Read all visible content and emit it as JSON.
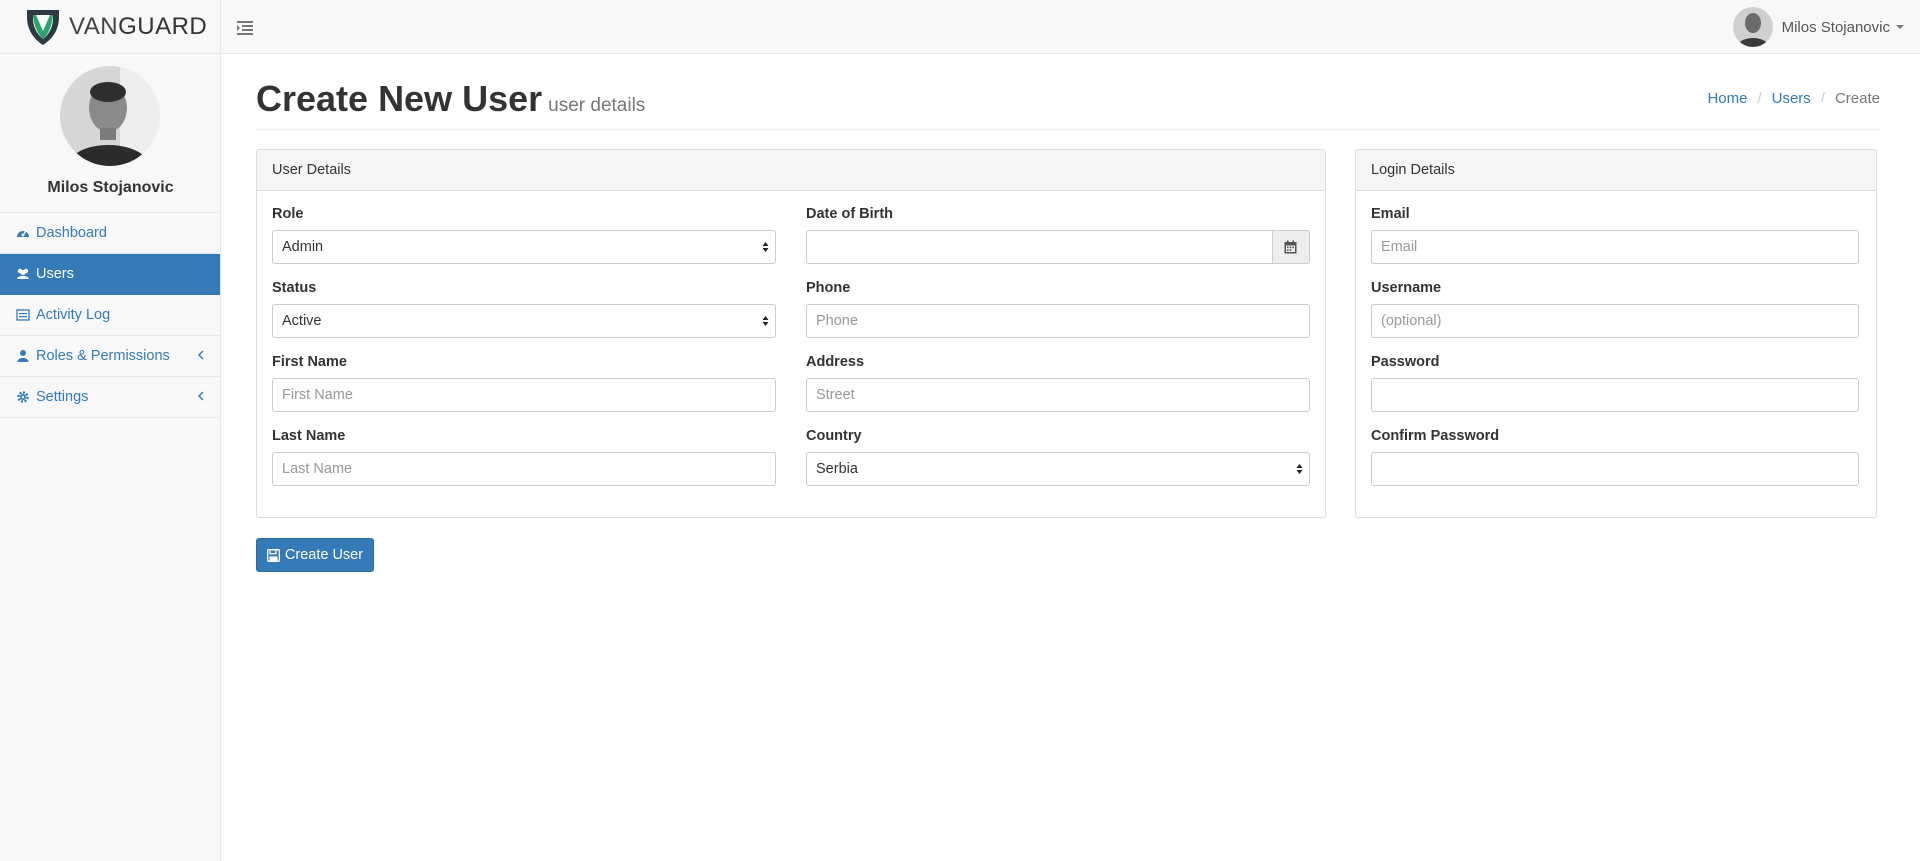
{
  "brand": {
    "name_light": "VAN",
    "name_bold": "GUARD"
  },
  "header": {
    "user_name": "Milos Stojanovic"
  },
  "sidebar": {
    "profile_name": "Milos Stojanovic",
    "items": [
      {
        "label": "Dashboard",
        "icon": "dashboard-icon"
      },
      {
        "label": "Users",
        "icon": "users-icon",
        "active": true
      },
      {
        "label": "Activity Log",
        "icon": "list-icon"
      },
      {
        "label": "Roles & Permissions",
        "icon": "user-icon",
        "has_children": true
      },
      {
        "label": "Settings",
        "icon": "gear-icon",
        "has_children": true
      }
    ]
  },
  "page": {
    "title": "Create New User",
    "subtitle": "user details",
    "breadcrumb": {
      "home": "Home",
      "users": "Users",
      "current": "Create"
    }
  },
  "user_details": {
    "heading": "User Details",
    "role": {
      "label": "Role",
      "value": "Admin"
    },
    "status": {
      "label": "Status",
      "value": "Active"
    },
    "first_name": {
      "label": "First Name",
      "placeholder": "First Name"
    },
    "last_name": {
      "label": "Last Name",
      "placeholder": "Last Name"
    },
    "dob": {
      "label": "Date of Birth",
      "value": ""
    },
    "phone": {
      "label": "Phone",
      "placeholder": "Phone"
    },
    "address": {
      "label": "Address",
      "placeholder": "Street"
    },
    "country": {
      "label": "Country",
      "value": "Serbia"
    }
  },
  "login_details": {
    "heading": "Login Details",
    "email": {
      "label": "Email",
      "placeholder": "Email"
    },
    "username": {
      "label": "Username",
      "placeholder": "(optional)"
    },
    "password": {
      "label": "Password",
      "value": ""
    },
    "confirm_password": {
      "label": "Confirm Password",
      "value": ""
    }
  },
  "actions": {
    "create_label": "Create User"
  },
  "colors": {
    "primary": "#337ab7",
    "logo_green": "#2ba36b",
    "logo_dark": "#2b3a42"
  }
}
